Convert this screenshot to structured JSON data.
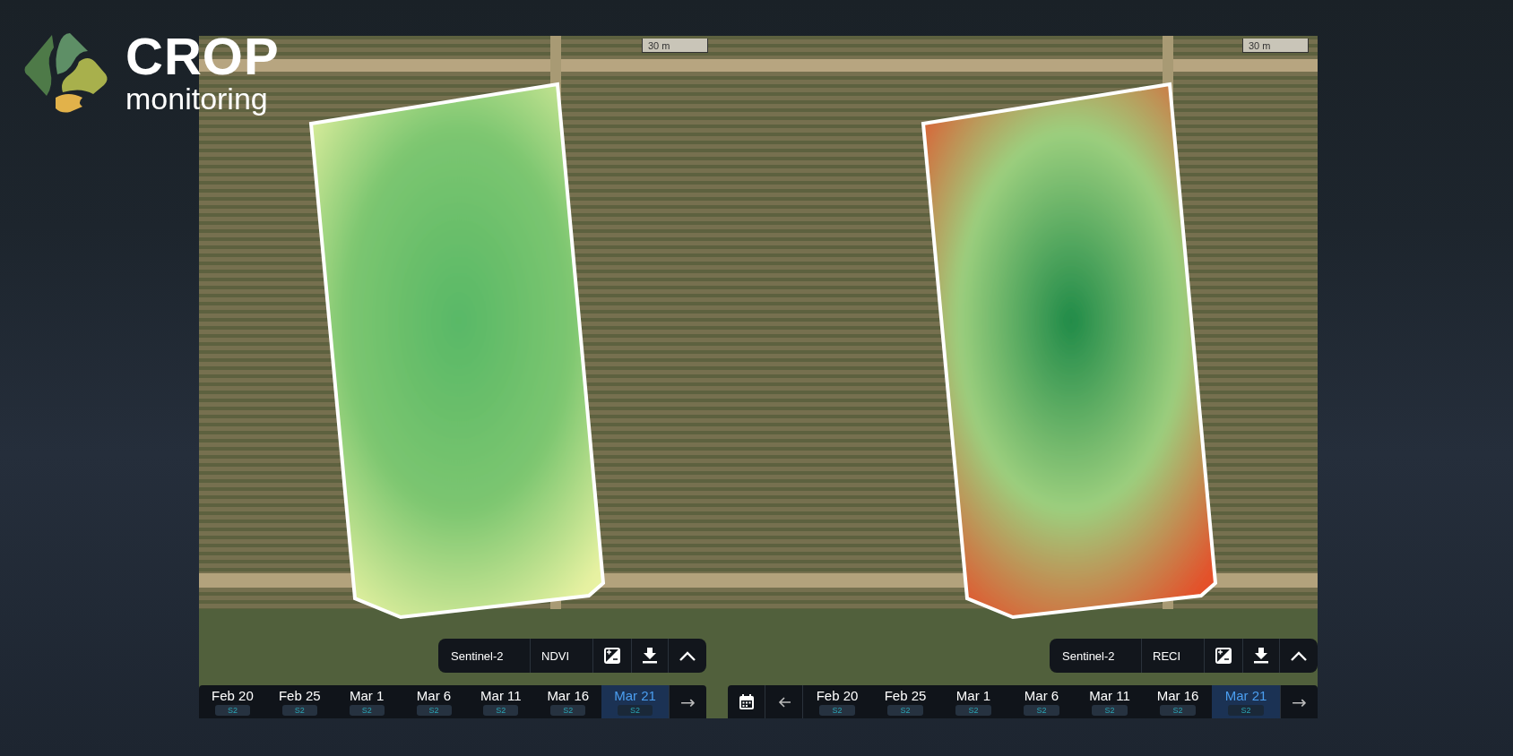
{
  "logo": {
    "title": "CROP",
    "subtitle": "monitoring"
  },
  "maps": [
    {
      "kind": "ndvi",
      "scale": "30 m",
      "source": "Sentinel-2",
      "index": "NDVI",
      "calendar_button": false,
      "back_arrow": false,
      "forward_arrow": "→",
      "dates": [
        {
          "label": "Feb 20",
          "tag": "S2",
          "selected": false
        },
        {
          "label": "Feb 25",
          "tag": "S2",
          "selected": false
        },
        {
          "label": "Mar 1",
          "tag": "S2",
          "selected": false
        },
        {
          "label": "Mar 6",
          "tag": "S2",
          "selected": false
        },
        {
          "label": "Mar 11",
          "tag": "S2",
          "selected": false
        },
        {
          "label": "Mar 16",
          "tag": "S2",
          "selected": false
        },
        {
          "label": "Mar 21",
          "tag": "S2",
          "selected": true
        }
      ]
    },
    {
      "kind": "reci",
      "scale": "30 m",
      "source": "Sentinel-2",
      "index": "RECI",
      "calendar_button": true,
      "back_arrow": true,
      "forward_arrow": "→",
      "dates": [
        {
          "label": "Feb 20",
          "tag": "S2",
          "selected": false
        },
        {
          "label": "Feb 25",
          "tag": "S2",
          "selected": false
        },
        {
          "label": "Mar 1",
          "tag": "S2",
          "selected": false
        },
        {
          "label": "Mar 6",
          "tag": "S2",
          "selected": false
        },
        {
          "label": "Mar 11",
          "tag": "S2",
          "selected": false
        },
        {
          "label": "Mar 16",
          "tag": "S2",
          "selected": false
        },
        {
          "label": "Mar 21",
          "tag": "S2",
          "selected": true
        }
      ]
    }
  ]
}
